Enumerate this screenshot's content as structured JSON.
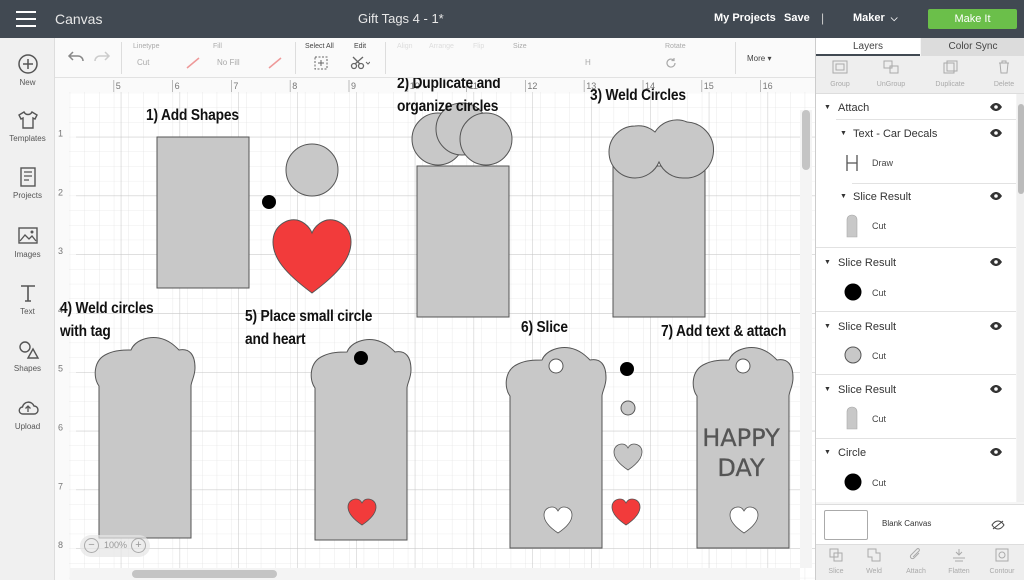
{
  "topbar": {
    "app_name": "Canvas",
    "doc_title": "Gift Tags 4 - 1*",
    "my_projects": "My Projects",
    "save": "Save",
    "separator": "|",
    "machine": "Maker",
    "make_it": "Make It",
    "make_it_color": "#6bbf4a",
    "bg_color": "#414952"
  },
  "leftrail": {
    "items": [
      {
        "label": "New",
        "icon": "plus-circle-icon"
      },
      {
        "label": "Templates",
        "icon": "tshirt-icon"
      },
      {
        "label": "Projects",
        "icon": "book-icon"
      },
      {
        "label": "Images",
        "icon": "image-icon"
      },
      {
        "label": "Text",
        "icon": "text-t-icon"
      },
      {
        "label": "Shapes",
        "icon": "shapes-icon"
      },
      {
        "label": "Upload",
        "icon": "cloud-upload-icon"
      }
    ]
  },
  "toolbar": {
    "linetype_label": "Linetype",
    "linetype_value": "Cut",
    "fill_label": "Fill",
    "fill_value": "No Fill",
    "select_all": "Select All",
    "edit": "Edit",
    "align": "Align",
    "arrange": "Arrange",
    "flip": "Flip",
    "size": "Size",
    "size_h": "H",
    "rotate": "Rotate",
    "more": "More"
  },
  "canvas": {
    "ruler_top": [
      "5",
      "6",
      "7",
      "8",
      "9",
      "10",
      "11",
      "12",
      "13",
      "14",
      "15",
      "16"
    ],
    "ruler_left": [
      "1",
      "2",
      "3",
      "4",
      "5",
      "6",
      "7",
      "8"
    ],
    "zoom": "100%",
    "shape_gray": "#c8c8c8",
    "heart_red": "#f23b3b"
  },
  "annotations": {
    "step1": "1) Add Shapes",
    "step2_line1": "2) Duplicate and",
    "step2_line2": "organize circles",
    "step3": "3) Weld Circles",
    "step4_line1": "4) Weld circles",
    "step4_line2": "with tag",
    "step5_line1": "5) Place small circle",
    "step5_line2": "and heart",
    "step6": "6) Slice",
    "step7": "7) Add text & attach",
    "tag_text_line1": "HAPPY",
    "tag_text_line2": "DAY"
  },
  "panel": {
    "tab_layers": "Layers",
    "tab_color_sync": "Color Sync",
    "actions": [
      "Group",
      "UnGroup",
      "Duplicate",
      "Delete"
    ],
    "layers": [
      {
        "name": "Attach",
        "level": 0
      },
      {
        "name": "Text - Car Decals",
        "level": 1,
        "sub": "Draw"
      },
      {
        "name": "Slice Result",
        "level": 1,
        "sub": "Cut"
      },
      {
        "name": "Slice Result",
        "level": 0,
        "sub": "Cut"
      },
      {
        "name": "Slice Result",
        "level": 0,
        "sub": "Cut"
      },
      {
        "name": "Slice Result",
        "level": 0,
        "sub": "Cut"
      },
      {
        "name": "Circle",
        "level": 0,
        "sub": "Cut"
      }
    ],
    "blank_canvas": "Blank Canvas",
    "bottom_actions": [
      "Slice",
      "Weld",
      "Attach",
      "Flatten",
      "Contour"
    ]
  }
}
